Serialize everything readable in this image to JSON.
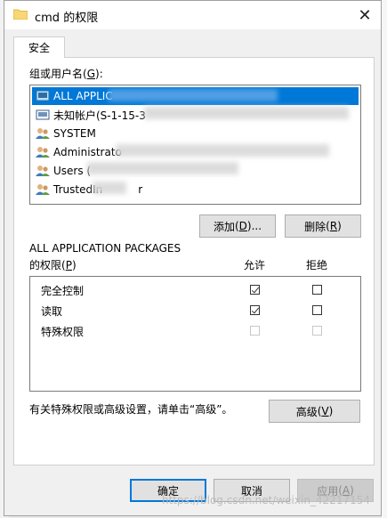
{
  "window": {
    "title": "cmd 的权限",
    "close_icon": "close-icon"
  },
  "tabs": [
    {
      "label": "安全"
    }
  ],
  "group_label": {
    "text": "组或用户名",
    "access": "G"
  },
  "users": [
    {
      "name": "ALL APPLIC",
      "icon": "app-package-icon",
      "selected": true
    },
    {
      "name": "未知帐户(S-1-15-3",
      "icon": "unknown-account-icon",
      "selected": false
    },
    {
      "name": "SYSTEM",
      "icon": "user-group-icon",
      "selected": false
    },
    {
      "name": "Administrato",
      "icon": "user-group-icon",
      "selected": false
    },
    {
      "name": "Users (",
      "icon": "user-group-icon",
      "selected": false
    },
    {
      "name": "TrustedIn",
      "suffix": "r",
      "icon": "user-group-icon",
      "selected": false
    }
  ],
  "buttons": {
    "add": {
      "text": "添加",
      "access": "D",
      "suffix": "..."
    },
    "remove": {
      "text": "删除",
      "access": "R"
    },
    "advanced": {
      "text": "高级",
      "access": "V"
    },
    "ok": "确定",
    "cancel": "取消",
    "apply": {
      "text": "应用",
      "access": "A"
    }
  },
  "perm_header": {
    "principal": "ALL APPLICATION PACKAGES",
    "label": "的权限",
    "access": "P",
    "allow": "允许",
    "deny": "拒绝"
  },
  "permissions": [
    {
      "name": "完全控制",
      "allow": true,
      "deny": false,
      "disabled": false
    },
    {
      "name": "读取",
      "allow": true,
      "deny": false,
      "disabled": false
    },
    {
      "name": "特殊权限",
      "allow": false,
      "deny": false,
      "disabled": true
    }
  ],
  "advanced_hint": "有关特殊权限或高级设置，请单击“高级”。",
  "watermark": "https://blog.csdn.net/weixin_42217154"
}
